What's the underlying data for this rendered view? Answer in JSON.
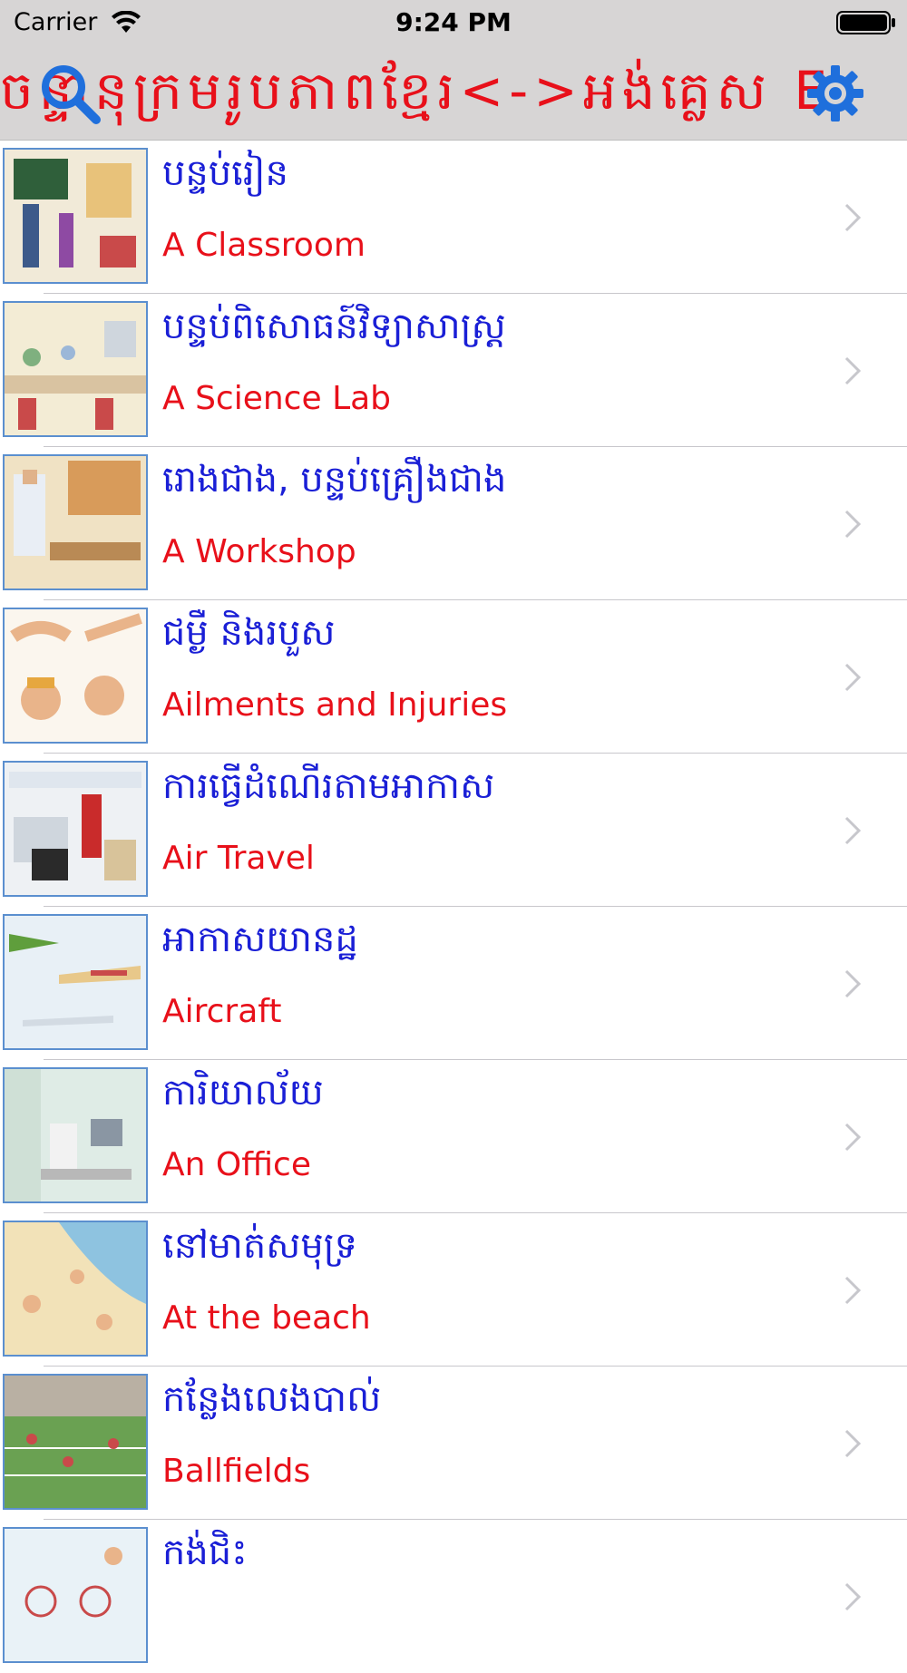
{
  "status_bar": {
    "carrier": "Carrier",
    "time": "9:24 PM"
  },
  "header": {
    "title_text": "ចន្ទានុក្រមរូបភាពខ្មែរ<->អង់គ្លេស E",
    "title_color": "#e8101a",
    "icons": {
      "left": "search-icon",
      "right": "gear-icon"
    },
    "icon_color": "#1f6fdc"
  },
  "colors": {
    "khmer_text": "#1a1fd6",
    "english_text": "#e8101a",
    "bar_bg": "#d7d5d5"
  },
  "items": [
    {
      "khmer": "បន្ទប់រៀន",
      "english": "A Classroom"
    },
    {
      "khmer": "បន្ទប់ពិសោធន៍វិទ្យាសាស្ត្រ",
      "english": "A Science Lab"
    },
    {
      "khmer": "រោងជាង, បន្ទប់គ្រឿងជាង",
      "english": "A Workshop"
    },
    {
      "khmer": "ជម្ងឺ និងរបួស",
      "english": "Ailments and Injuries"
    },
    {
      "khmer": "ការធ្វើដំណើរតាមអាកាស",
      "english": "Air Travel"
    },
    {
      "khmer": "អាកាសយានដ្ឋ",
      "english": "Aircraft"
    },
    {
      "khmer": "ការិយាល័យ",
      "english": "An Office"
    },
    {
      "khmer": "នៅមាត់សមុទ្រ",
      "english": "At the beach"
    },
    {
      "khmer": "កន្លែងលេងបាល់",
      "english": "Ballfields"
    },
    {
      "khmer": "កង់ជិះ",
      "english": ""
    }
  ]
}
